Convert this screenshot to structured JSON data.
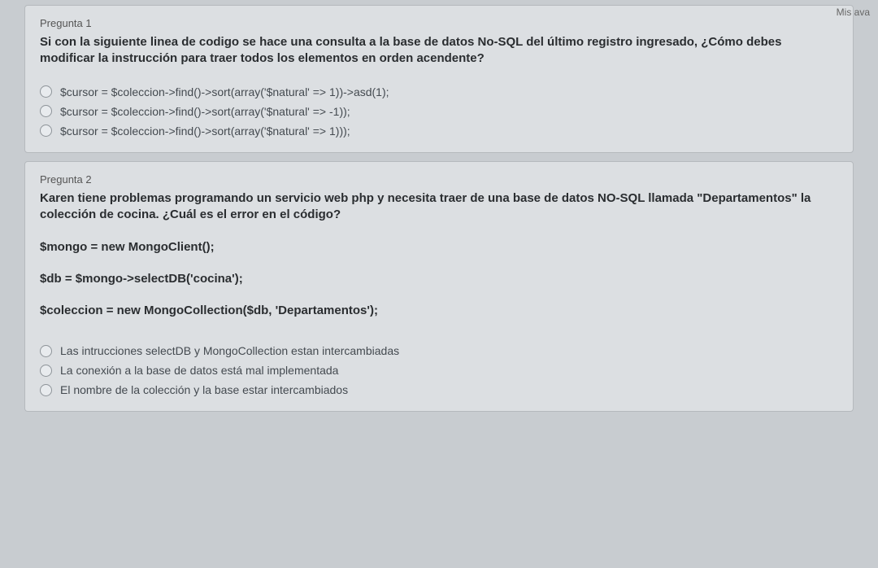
{
  "top_right": "Mis ava",
  "q1": {
    "number": "Pregunta 1",
    "text": "Si con la siguiente linea de codigo se hace una consulta a la base de datos No-SQL del último registro ingresado, ¿Cómo debes modificar la instrucción para traer todos los elementos en orden acendente?",
    "options": [
      "$cursor = $coleccion->find()->sort(array('$natural' => 1))->asd(1);",
      "$cursor = $coleccion->find()->sort(array('$natural' => -1));",
      "$cursor = $coleccion->find()->sort(array('$natural' => 1)));"
    ]
  },
  "q2": {
    "number": "Pregunta 2",
    "text": "Karen tiene problemas programando un servicio web php y necesita traer de una base de datos NO-SQL llamada \"Departamentos\" la colección de cocina. ¿Cuál es el error en el código?",
    "code": "$mongo = new MongoClient();\n$db = $mongo->selectDB('cocina');\n$coleccion = new MongoCollection($db, 'Departamentos');",
    "options": [
      "Las intrucciones selectDB y MongoCollection estan intercambiadas",
      "La conexión a la base de datos está mal implementada",
      "El nombre de la colección y la base estar intercambiados"
    ]
  }
}
